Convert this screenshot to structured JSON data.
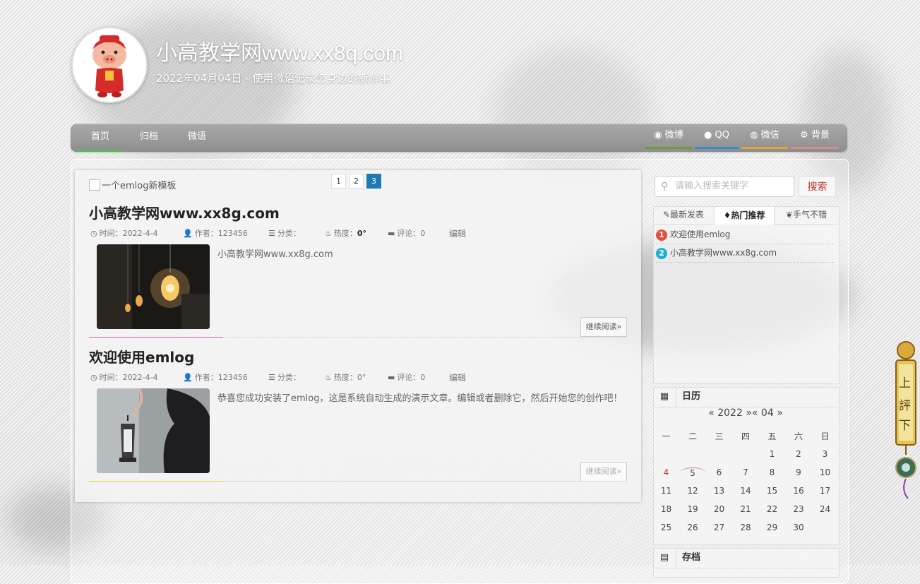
{
  "header": {
    "site_title": "小高教学网www.xx8q.com",
    "site_subtitle": "2022年04月04日 - 使用微语记录您身边的新鲜事"
  },
  "nav": {
    "items": [
      {
        "label": "首页",
        "active": true
      },
      {
        "label": "归档",
        "active": false
      },
      {
        "label": "微语",
        "active": false
      }
    ],
    "social": [
      {
        "label": "微博",
        "icon": "weibo-icon",
        "color": "#6a9d3a"
      },
      {
        "label": "QQ",
        "icon": "qq-icon",
        "color": "#2e8fd0"
      },
      {
        "label": "微信",
        "icon": "wechat-icon",
        "color": "#e8a23b"
      },
      {
        "label": "背景",
        "icon": "gears-icon",
        "color": "#d98b8b"
      }
    ]
  },
  "notice": "一个emlog新模板",
  "pagination": [
    "1",
    "2",
    "3"
  ],
  "posts": [
    {
      "title": "小高教学网www.xx8g.com",
      "time_label": "时间：",
      "time": "2022-4-4",
      "author_label": "作者：",
      "author": "123456",
      "category_label": "分类：",
      "category": "",
      "heat_label": "热度：",
      "heat": "0°",
      "comment_label": "评论：",
      "comments": "0",
      "edit": "编辑",
      "excerpt": "小高教学网www.xx8g.com",
      "read_more": "继续阅读»",
      "accent": "#e05aa6"
    },
    {
      "title": "欢迎使用emlog",
      "time_label": "时间：",
      "time": "2022-4-4",
      "author_label": "作者：",
      "author": "123456",
      "category_label": "分类：",
      "category": "",
      "heat_label": "热度：",
      "heat": "0°",
      "comment_label": "评论：",
      "comments": "0",
      "edit": "编辑",
      "excerpt": "恭喜您成功安装了emlog，这是系统自动生成的演示文章。编辑或者删除它，然后开始您的创作吧！",
      "read_more": "继续阅读»",
      "accent": "#e8d23b"
    }
  ],
  "sidebar": {
    "search_placeholder": "请输入搜索关键字",
    "search_button": "搜索",
    "tabs": [
      "最新发表",
      "热门推荐",
      "手气不错"
    ],
    "hot_list": [
      {
        "num": "1",
        "title": "欢迎使用emlog",
        "color": "#e74c3c"
      },
      {
        "num": "2",
        "title": "小高教学网www.xx8g.com",
        "color": "#1ab0d8"
      }
    ],
    "calendar_title": "日历",
    "calendar_nav": {
      "prev": "«",
      "year": "2022",
      "mid": "»«",
      "month": "04",
      "next": "»"
    },
    "weekdays": [
      "一",
      "二",
      "三",
      "四",
      "五",
      "六",
      "日"
    ],
    "days": [
      [
        "",
        "",
        "",
        "",
        "1",
        "2",
        "3"
      ],
      [
        "4",
        "5",
        "6",
        "7",
        "8",
        "9",
        "10"
      ],
      [
        "11",
        "12",
        "13",
        "14",
        "15",
        "16",
        "17"
      ],
      [
        "18",
        "19",
        "20",
        "21",
        "22",
        "23",
        "24"
      ],
      [
        "25",
        "26",
        "27",
        "28",
        "29",
        "30",
        ""
      ]
    ],
    "archive_title": "存档"
  },
  "scroller": {
    "up": "上",
    "mid": "評",
    "down": "下"
  }
}
